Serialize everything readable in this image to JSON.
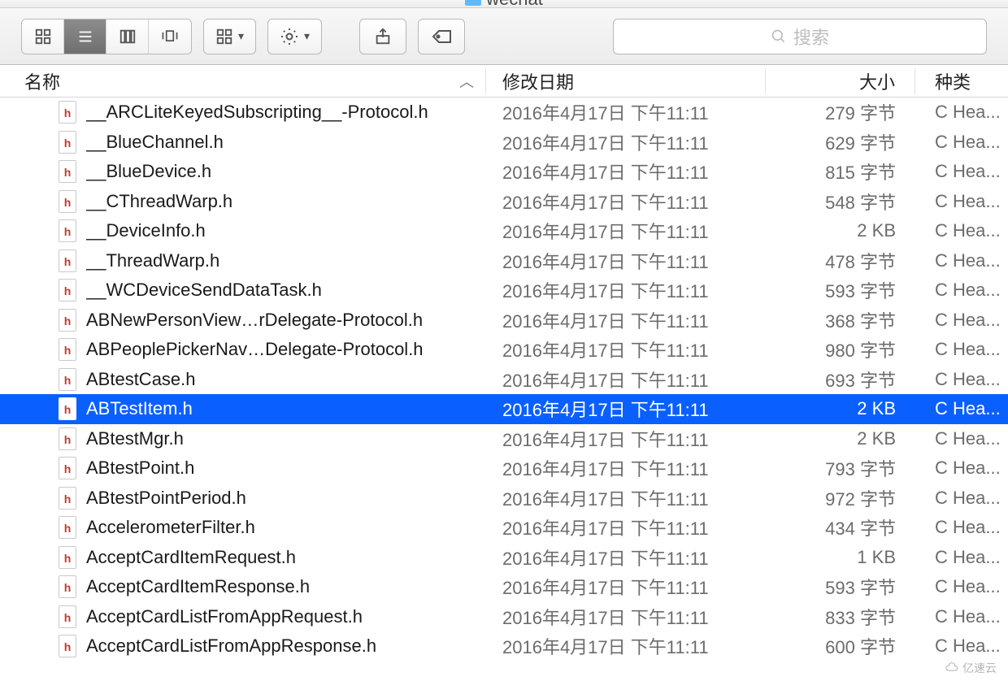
{
  "window": {
    "title": "wechat"
  },
  "toolbar": {
    "search_placeholder": "搜索"
  },
  "columns": {
    "name": "名称",
    "date": "修改日期",
    "size": "大小",
    "kind": "种类"
  },
  "kind_label": "C Hea...",
  "date_value": "2016年4月17日 下午11:11",
  "files": [
    {
      "name": "__ARCLiteKeyedSubscripting__-Protocol.h",
      "size": "279 字节",
      "selected": false
    },
    {
      "name": "__BlueChannel.h",
      "size": "629 字节",
      "selected": false
    },
    {
      "name": "__BlueDevice.h",
      "size": "815 字节",
      "selected": false
    },
    {
      "name": "__CThreadWarp.h",
      "size": "548 字节",
      "selected": false
    },
    {
      "name": "__DeviceInfo.h",
      "size": "2 KB",
      "selected": false
    },
    {
      "name": "__ThreadWarp.h",
      "size": "478 字节",
      "selected": false
    },
    {
      "name": "__WCDeviceSendDataTask.h",
      "size": "593 字节",
      "selected": false
    },
    {
      "name": "ABNewPersonView…rDelegate-Protocol.h",
      "size": "368 字节",
      "selected": false
    },
    {
      "name": "ABPeoplePickerNav…Delegate-Protocol.h",
      "size": "980 字节",
      "selected": false
    },
    {
      "name": "ABtestCase.h",
      "size": "693 字节",
      "selected": false
    },
    {
      "name": "ABTestItem.h",
      "size": "2 KB",
      "selected": true
    },
    {
      "name": "ABtestMgr.h",
      "size": "2 KB",
      "selected": false
    },
    {
      "name": "ABtestPoint.h",
      "size": "793 字节",
      "selected": false
    },
    {
      "name": "ABtestPointPeriod.h",
      "size": "972 字节",
      "selected": false
    },
    {
      "name": "AccelerometerFilter.h",
      "size": "434 字节",
      "selected": false
    },
    {
      "name": "AcceptCardItemRequest.h",
      "size": "1 KB",
      "selected": false
    },
    {
      "name": "AcceptCardItemResponse.h",
      "size": "593 字节",
      "selected": false
    },
    {
      "name": "AcceptCardListFromAppRequest.h",
      "size": "833 字节",
      "selected": false
    },
    {
      "name": "AcceptCardListFromAppResponse.h",
      "size": "600 字节",
      "selected": false
    }
  ],
  "watermark": "亿速云"
}
